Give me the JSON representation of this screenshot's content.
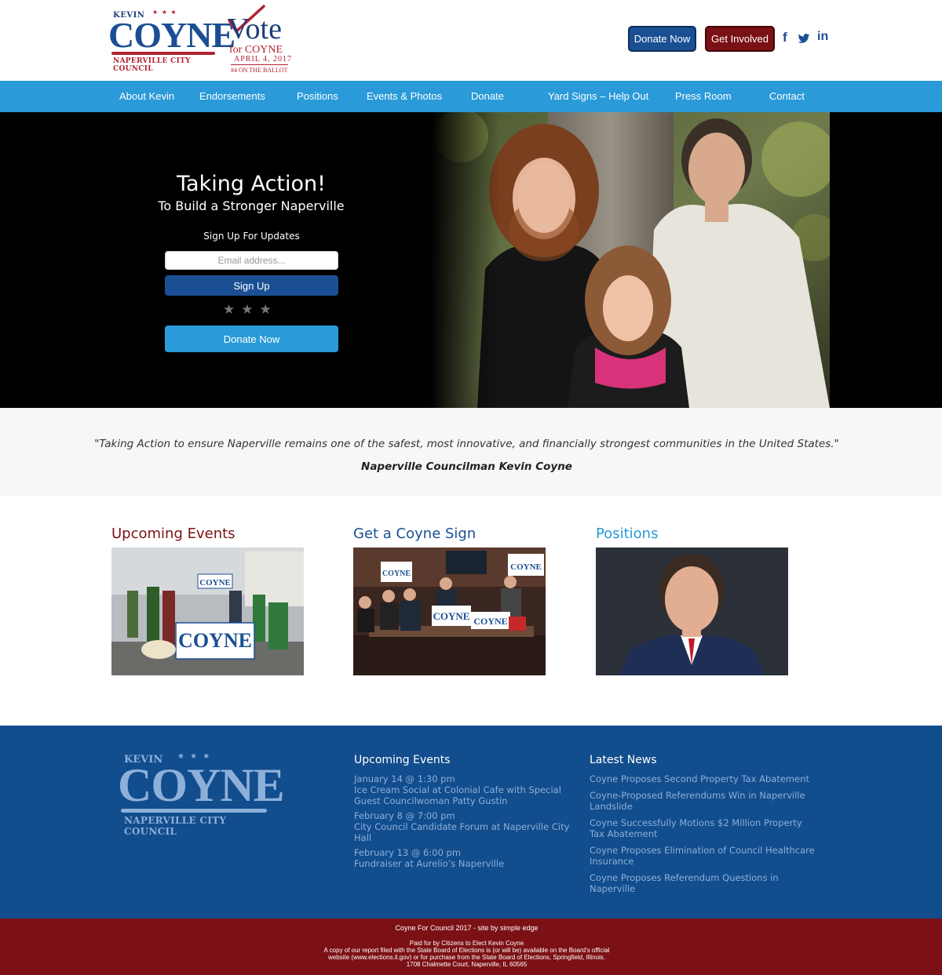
{
  "header": {
    "logo": {
      "kevin": "KEVIN",
      "name": "COYNE",
      "council": "NAPERVILLE CITY COUNCIL"
    },
    "vote_logo": {
      "vote": "Vote",
      "for": "for COYNE",
      "date": "APRIL 4, 2017",
      "ballot": "#4 ON THE BALLOT"
    },
    "donate_label": "Donate Now",
    "involved_label": "Get Involved",
    "social": [
      "facebook-icon",
      "twitter-icon",
      "linkedin-icon"
    ],
    "social_labels": {
      "facebook": "f",
      "linkedin": "in"
    }
  },
  "nav": {
    "items": [
      {
        "label": "About Kevin"
      },
      {
        "label": "Endorsements"
      },
      {
        "label": "Positions"
      },
      {
        "label": "Events & Photos"
      },
      {
        "label": "Donate"
      },
      {
        "label": "Yard Signs – Help Out"
      },
      {
        "label": "Press Room"
      },
      {
        "label": "Contact"
      }
    ]
  },
  "hero": {
    "title": "Taking Action!",
    "subtitle": "To Build a Stronger Naperville",
    "signup_heading": "Sign Up For Updates",
    "email_placeholder": "Email address...",
    "signup_label": "Sign Up",
    "stars": "★★★",
    "donate_label": "Donate Now"
  },
  "quote": {
    "text": "\"Taking Action to ensure Naperville remains one of the safest, most innovative, and financially strongest communities in the United States.\"",
    "author": "Naperville Councilman Kevin Coyne"
  },
  "columns": [
    {
      "title": "Upcoming Events",
      "sign_text": "COYNE"
    },
    {
      "title": "Get a Coyne Sign",
      "sign_text": "COYNE"
    },
    {
      "title": "Positions"
    }
  ],
  "footer": {
    "logo": {
      "kevin": "KEVIN",
      "name": "COYNE",
      "council": "NAPERVILLE CITY COUNCIL"
    },
    "events_heading": "Upcoming Events",
    "events": [
      {
        "date": "January 14 @ 1:30 pm",
        "title": "Ice Cream Social at Colonial Cafe with Special Guest Councilwoman Patty Gustin"
      },
      {
        "date": "February 8 @ 7:00 pm",
        "title": "City Council Candidate Forum at Naperville City Hall"
      },
      {
        "date": "February 13 @ 6:00 pm",
        "title": "Fundraiser at Aurelio’s Naperville"
      }
    ],
    "news_heading": "Latest News",
    "news": [
      {
        "title": "Coyne Proposes Second Property Tax Abatement"
      },
      {
        "title": "Coyne-Proposed Referendums Win in Naperville Landslide"
      },
      {
        "title": "Coyne Successfully Motions $2 Million Property Tax Abatement"
      },
      {
        "title": "Coyne Proposes Elimination of Council Healthcare Insurance"
      },
      {
        "title": "Coyne Proposes Referendum Questions in Naperville"
      }
    ]
  },
  "bottom": {
    "credit": "Coyne For Council 2017 - site by simple edge",
    "paid_lines": [
      "Paid for by Citizens to Elect Kevin Coyne",
      "A copy of our report filed with the State Board of Elections is (or will be) available on the Board’s official",
      "website (www.elections.il.gov) or for purchase from the State Board of Elections, Springfield, Illinois.",
      "1708 Chalmette Court, Naperville, IL 60565"
    ]
  },
  "colors": {
    "brand_blue": "#1b4f93",
    "nav_blue": "#2a9ad8",
    "brand_red": "#7c1115",
    "events_title": "#7c1115",
    "sign_title": "#1b4f93",
    "positions_title": "#2a9ad8"
  }
}
